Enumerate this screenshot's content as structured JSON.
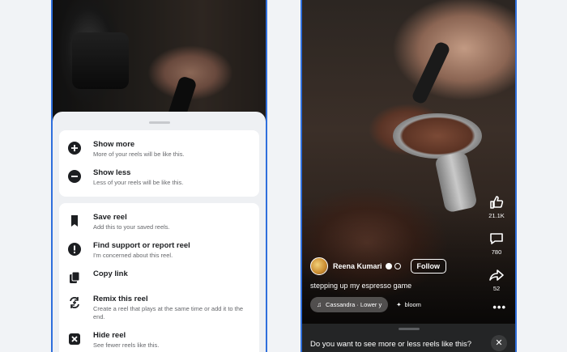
{
  "left_sheet": {
    "group1": [
      {
        "title": "Show more",
        "subtitle": "More of your reels will be like this.",
        "icon": "plus-circle-icon"
      },
      {
        "title": "Show less",
        "subtitle": "Less of your reels will be like this.",
        "icon": "minus-circle-icon"
      }
    ],
    "group2": [
      {
        "title": "Save reel",
        "subtitle": "Add this to your saved reels.",
        "icon": "bookmark-icon"
      },
      {
        "title": "Find support or report reel",
        "subtitle": "I'm concerned about this reel.",
        "icon": "exclamation-icon"
      },
      {
        "title": "Copy link",
        "subtitle": "",
        "icon": "copy-icon"
      },
      {
        "title": "Remix this reel",
        "subtitle": "Create a reel that plays at the same time or add it to the end.",
        "icon": "remix-icon"
      },
      {
        "title": "Hide reel",
        "subtitle": "See fewer reels like this.",
        "icon": "hide-icon"
      }
    ]
  },
  "reel": {
    "author": "Reena Kumari",
    "follow_label": "Follow",
    "caption": "stepping up my espresso game",
    "audio_chip": "Cassandra · Lower y",
    "effect_chip": "bloom",
    "likes": "21.1K",
    "comments": "780",
    "shares": "52",
    "prompt_text": "Do you want to see more or less reels like this?"
  }
}
